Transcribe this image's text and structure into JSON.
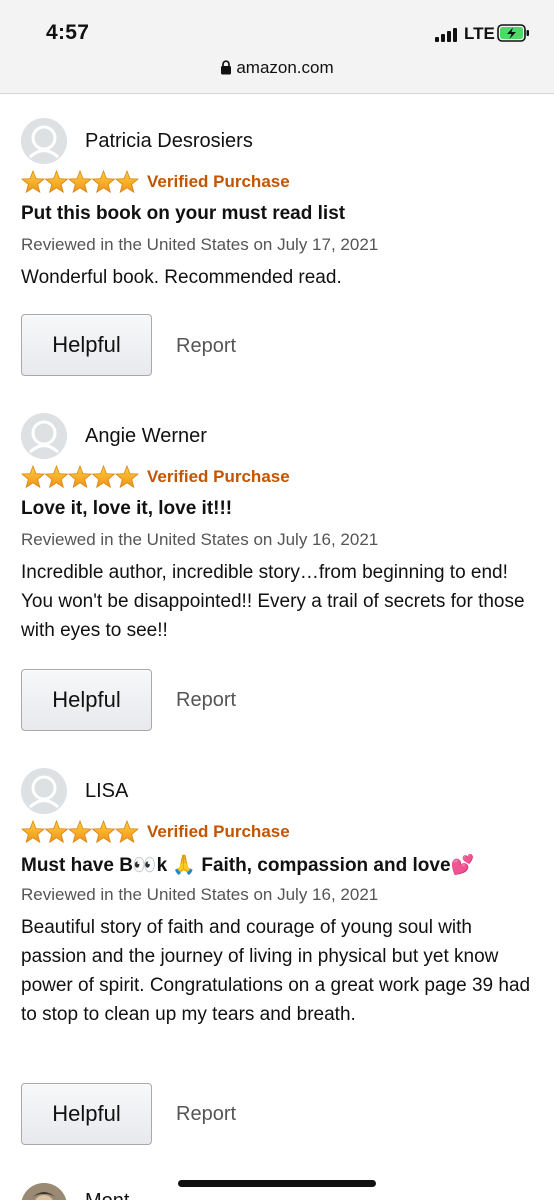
{
  "status_bar": {
    "time": "4:57",
    "network": "LTE",
    "url": "amazon.com",
    "battery_color": "#4cd964"
  },
  "colors": {
    "star": "#f6a623",
    "verified": "#c45500",
    "meta_text": "#555555"
  },
  "reviews": [
    {
      "reviewer": "Patricia Desrosiers",
      "rating": 5,
      "badge": "Verified Purchase",
      "title": "Put this book on your must read list",
      "date": "Reviewed in the United States on July 17, 2021",
      "body": "Wonderful book. Recommended read.",
      "helpful_label": "Helpful",
      "report_label": "Report"
    },
    {
      "reviewer": "Angie Werner",
      "rating": 5,
      "badge": "Verified Purchase",
      "title": "Love it, love it, love it!!!",
      "date": "Reviewed in the United States on July 16, 2021",
      "body": "Incredible author, incredible story…from beginning to end! You won't be disappointed!! Every a trail of secrets for those with eyes to see!!",
      "helpful_label": "Helpful",
      "report_label": "Report"
    },
    {
      "reviewer": "LISA",
      "rating": 5,
      "badge": "Verified Purchase",
      "title": "Must have B👀k 🙏 Faith, compassion and love💕",
      "date": "Reviewed in the United States on July 16, 2021",
      "body": "Beautiful story of faith and courage of young soul with passion and the journey of living in physical but yet know power of spirit. Congratulations on a great work page 39 had to stop to clean up my tears and breath.",
      "helpful_label": "Helpful",
      "report_label": "Report"
    }
  ],
  "next_reviewer_peek": "Mont"
}
